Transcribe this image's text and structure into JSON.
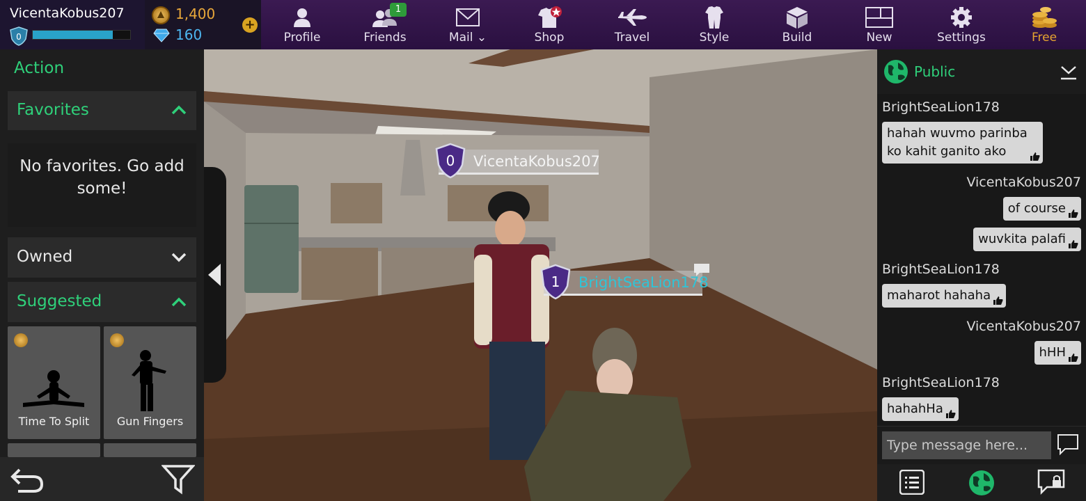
{
  "user": {
    "name": "VicentaKobus207",
    "level": "0",
    "xp_progress": 0.82
  },
  "currency": {
    "coins": "1,400",
    "gems": "160"
  },
  "nav": [
    {
      "id": "profile",
      "label": "Profile",
      "icon": "person-icon"
    },
    {
      "id": "friends",
      "label": "Friends",
      "icon": "friends-icon",
      "badge": "1"
    },
    {
      "id": "mail",
      "label": "Mail ⌄",
      "icon": "mail-icon"
    },
    {
      "id": "shop",
      "label": "Shop",
      "icon": "shop-shirt-star-icon"
    },
    {
      "id": "travel",
      "label": "Travel",
      "icon": "airplane-icon"
    },
    {
      "id": "style",
      "label": "Style",
      "icon": "outfit-icon"
    },
    {
      "id": "build",
      "label": "Build",
      "icon": "box-icon"
    },
    {
      "id": "new",
      "label": "New",
      "icon": "new-window-icon"
    },
    {
      "id": "settings",
      "label": "Settings",
      "icon": "gear-icon"
    },
    {
      "id": "free",
      "label": "Free",
      "icon": "coin-stack-icon"
    }
  ],
  "left_panel": {
    "title": "Action",
    "favorites_title": "Favorites",
    "favorites_empty": "No favorites. Go add some!",
    "owned_title": "Owned",
    "suggested_title": "Suggested",
    "emotes": [
      {
        "label": "Time To Split"
      },
      {
        "label": "Gun Fingers"
      }
    ]
  },
  "scene": {
    "tags": [
      {
        "name": "VicentaKobus207",
        "level": "0"
      },
      {
        "name": "BrightSeaLion178",
        "level": "1"
      }
    ]
  },
  "chat": {
    "channel": "Public",
    "messages": [
      {
        "author": "BrightSeaLion178",
        "text_lines": [
          "hahah wuvmo parinba",
          "ko kahit ganito ako"
        ],
        "side": "left"
      },
      {
        "author": "VicentaKobus207",
        "text_lines": [
          "of course"
        ],
        "side": "right"
      },
      {
        "author": "",
        "text_lines": [
          "wuvkita palafi"
        ],
        "side": "right"
      },
      {
        "author": "BrightSeaLion178",
        "text_lines": [
          "maharot hahaha"
        ],
        "side": "left"
      },
      {
        "author": "VicentaKobus207",
        "text_lines": [
          "hHH"
        ],
        "side": "right"
      },
      {
        "author": "BrightSeaLion178",
        "text_lines": [
          "hahahHa"
        ],
        "side": "left"
      }
    ],
    "input_placeholder": "Type message here..."
  },
  "colors": {
    "accent_green": "#2fd07a",
    "coin_gold": "#e8a73a",
    "gem_blue": "#4db6f0",
    "topbar_purple": "#3b1a52",
    "tag_cyan": "#2fc5d8"
  }
}
